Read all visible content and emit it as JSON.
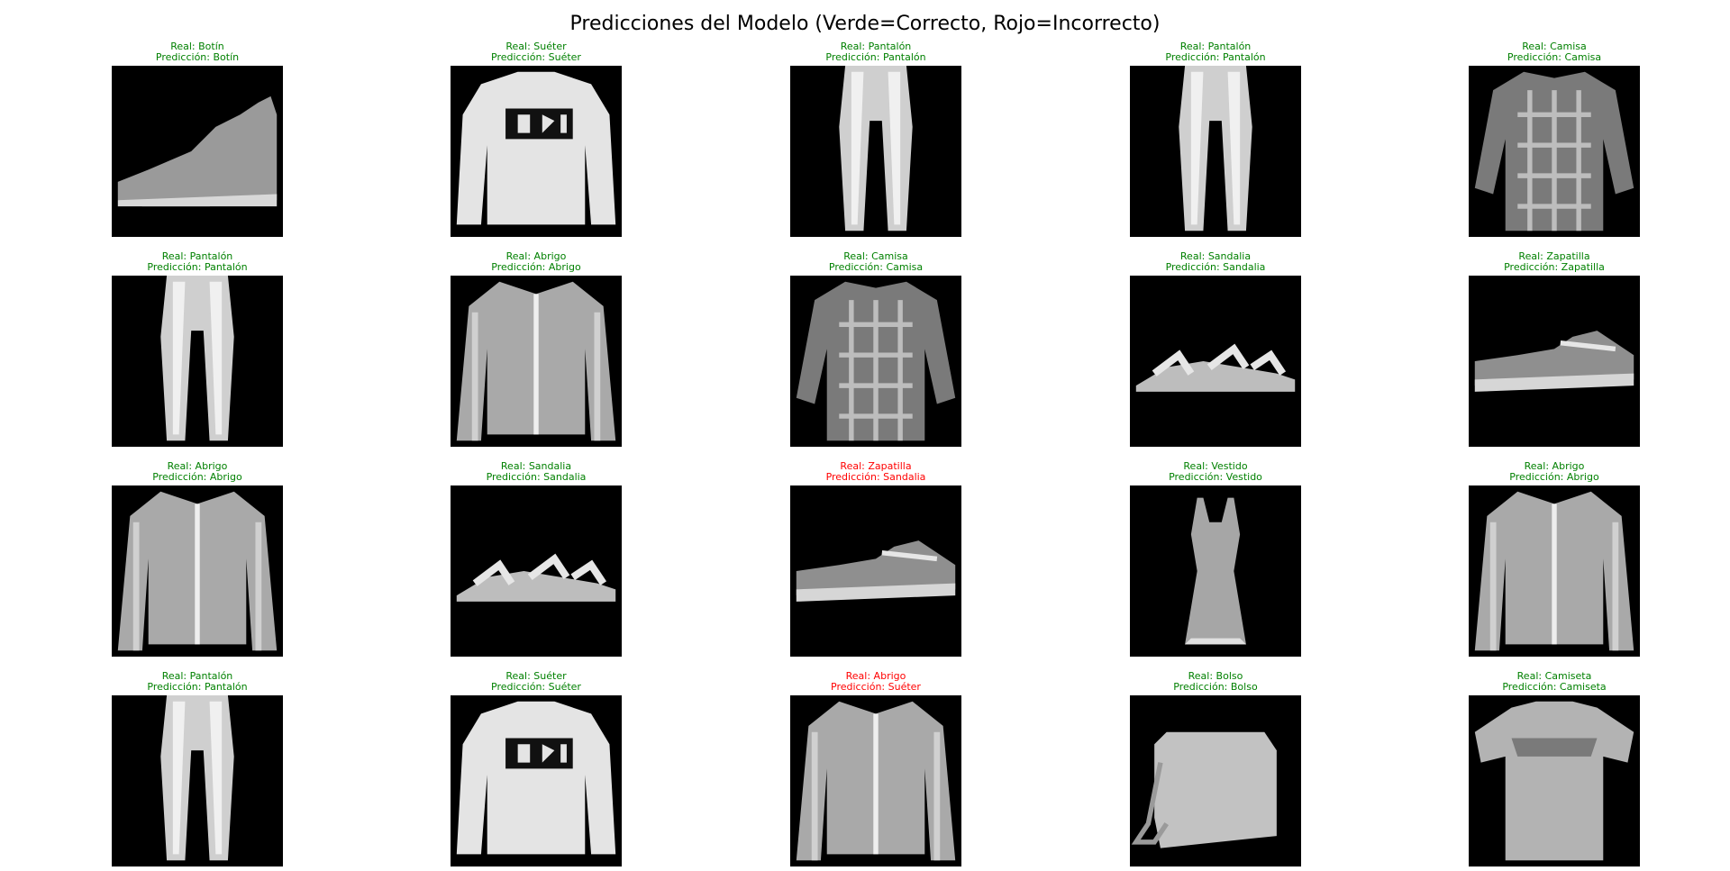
{
  "figure": {
    "title": "Predicciones del Modelo (Verde=Correcto, Rojo=Incorrecto)"
  },
  "colors": {
    "correct": "#008000",
    "incorrect": "#ff0000",
    "background": "#ffffff",
    "image_background": "#000000"
  },
  "panels": [
    {
      "real": "Real: Botín",
      "pred": "Predicción: Botín",
      "correct": true,
      "item": "ankle-boot"
    },
    {
      "real": "Real: Suéter",
      "pred": "Predicción: Suéter",
      "correct": true,
      "item": "sweater"
    },
    {
      "real": "Real: Pantalón",
      "pred": "Predicción: Pantalón",
      "correct": true,
      "item": "trousers"
    },
    {
      "real": "Real: Pantalón",
      "pred": "Predicción: Pantalón",
      "correct": true,
      "item": "trousers"
    },
    {
      "real": "Real: Camisa",
      "pred": "Predicción: Camisa",
      "correct": true,
      "item": "shirt"
    },
    {
      "real": "Real: Pantalón",
      "pred": "Predicción: Pantalón",
      "correct": true,
      "item": "trousers"
    },
    {
      "real": "Real: Abrigo",
      "pred": "Predicción: Abrigo",
      "correct": true,
      "item": "coat"
    },
    {
      "real": "Real: Camisa",
      "pred": "Predicción: Camisa",
      "correct": true,
      "item": "shirt"
    },
    {
      "real": "Real: Sandalia",
      "pred": "Predicción: Sandalia",
      "correct": true,
      "item": "sandal"
    },
    {
      "real": "Real: Zapatilla",
      "pred": "Predicción: Zapatilla",
      "correct": true,
      "item": "sneaker"
    },
    {
      "real": "Real: Abrigo",
      "pred": "Predicción: Abrigo",
      "correct": true,
      "item": "coat"
    },
    {
      "real": "Real: Sandalia",
      "pred": "Predicción: Sandalia",
      "correct": true,
      "item": "sandal"
    },
    {
      "real": "Real: Zapatilla",
      "pred": "Predicción: Sandalia",
      "correct": false,
      "item": "sneaker"
    },
    {
      "real": "Real: Vestido",
      "pred": "Predicción: Vestido",
      "correct": true,
      "item": "dress"
    },
    {
      "real": "Real: Abrigo",
      "pred": "Predicción: Abrigo",
      "correct": true,
      "item": "coat"
    },
    {
      "real": "Real: Pantalón",
      "pred": "Predicción: Pantalón",
      "correct": true,
      "item": "trousers"
    },
    {
      "real": "Real: Suéter",
      "pred": "Predicción: Suéter",
      "correct": true,
      "item": "sweater"
    },
    {
      "real": "Real: Abrigo",
      "pred": "Predicción: Suéter",
      "correct": false,
      "item": "coat"
    },
    {
      "real": "Real: Bolso",
      "pred": "Predicción: Bolso",
      "correct": true,
      "item": "bag"
    },
    {
      "real": "Real: Camiseta",
      "pred": "Predicción: Camiseta",
      "correct": true,
      "item": "tshirt"
    }
  ]
}
